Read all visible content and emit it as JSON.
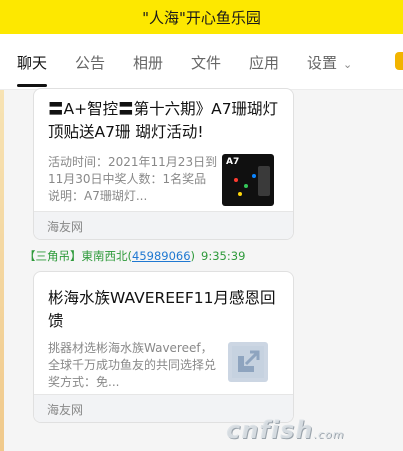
{
  "window": {
    "title": "\"人海\"开心鱼乐园"
  },
  "tabs": [
    {
      "label": "聊天",
      "active": true
    },
    {
      "label": "公告"
    },
    {
      "label": "相册"
    },
    {
      "label": "文件"
    },
    {
      "label": "应用"
    },
    {
      "label": "设置"
    }
  ],
  "messages": [
    {
      "title": "〓A+智控〓第十六期》A7珊瑚灯顶贴送A7珊 瑚灯活动!",
      "description": "活动时间：2021年11月23日到11月30日中奖人数：1名奖品说明：A7珊瑚灯...",
      "thumbnail_label": "A7",
      "source": "海友网"
    },
    {
      "title": "彬海水族WAVEREEF11月感恩回馈",
      "description": "挑器材选彬海水族Wavereef，全球千万成功鱼友的共同选择兑奖方式：免...",
      "source": "海友网"
    }
  ],
  "sender": {
    "tag": "【三角吊】",
    "name": "東南西北",
    "qq": "45989066",
    "time": "9:35:39"
  },
  "watermark": {
    "main": "cnfish",
    "suffix": ".com"
  }
}
